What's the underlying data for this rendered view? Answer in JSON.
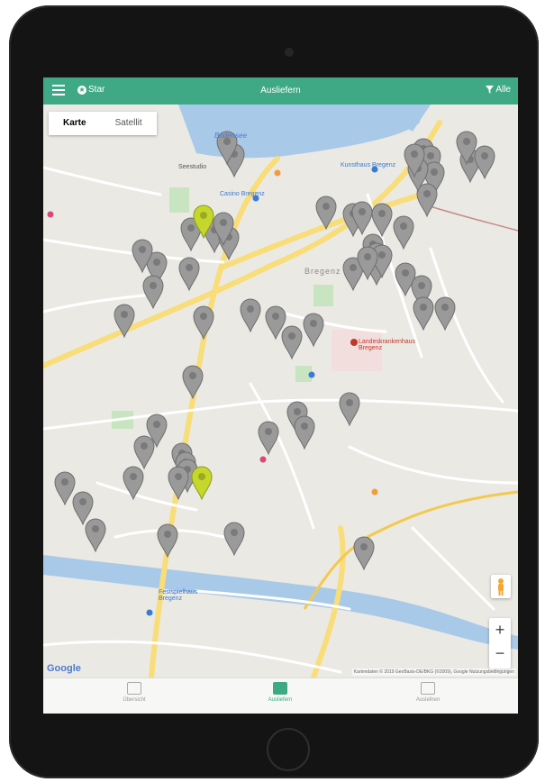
{
  "header": {
    "title": "Ausliefern",
    "star_label": "Star",
    "filter_label": "Alle"
  },
  "map_type": {
    "options": [
      "Karte",
      "Satellit"
    ],
    "selected": "Karte"
  },
  "places": [
    {
      "name": "Bregenz",
      "color": "#8a8a8a"
    },
    {
      "name": "Landeskrankenhaus Bregenz",
      "color": "#c0392b"
    },
    {
      "name": "Kunsthaus Bregenz",
      "color": "#3a7bd5"
    },
    {
      "name": "Festspielhaus Bregenz",
      "color": "#3a7bd5"
    },
    {
      "name": "Casino Bregenz",
      "color": "#3a7bd5"
    },
    {
      "name": "Seestudio",
      "color": "#3a7bd5"
    },
    {
      "name": "Bodensee",
      "color": "#4a7bd1"
    }
  ],
  "markers": {
    "gray_count": 58,
    "yellow_count": 2,
    "gray_color": "#9a9a9a",
    "yellow_color": "#c6d72b"
  },
  "map_controls": {
    "zoom_in": "+",
    "zoom_out": "−"
  },
  "branding": {
    "google": "Google",
    "attribution": "Kartendaten © 2019 GeoBasis-DE/BKG (©2009), Google  Nutzungsbedingungen"
  },
  "bottom_nav": [
    {
      "label": "Übersicht",
      "active": false
    },
    {
      "label": "Ausliefern",
      "active": true
    },
    {
      "label": "Ausleihen",
      "active": false
    }
  ],
  "colors": {
    "accent": "#3fa986",
    "water": "#a9c9e9",
    "road": "#f8dd79",
    "park": "#c8e4c0"
  }
}
